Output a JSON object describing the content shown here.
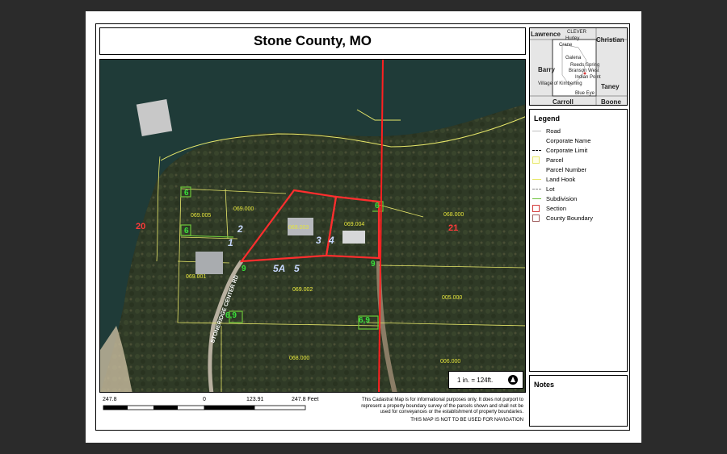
{
  "title": "Stone County, MO",
  "inset_map": {
    "labels": [
      "Lawrence",
      "Christian",
      "Barry",
      "Taney",
      "Carroll",
      "Boone",
      "CLEVER",
      "Hurley",
      "Crane",
      "Galena",
      "Reeds Spring",
      "Branson West",
      "Indian Point",
      "Village of Kimberling",
      "Blue Eye"
    ]
  },
  "map": {
    "parcel_numbers": [
      "069.005",
      "069.000",
      "069.003",
      "069.004",
      "068.000",
      "069.001",
      "069.002",
      "005.000",
      "068.000",
      "006.000"
    ],
    "sections": [
      "20",
      "21"
    ],
    "lots": [
      "1",
      "2",
      "3",
      "4",
      "5A",
      "5"
    ],
    "subdivision_marks": [
      "6",
      "6",
      "6",
      "9",
      "9",
      "6,9",
      "6,9"
    ],
    "road_name": "STONERIDGE CENTER RD"
  },
  "scale_text": "1 in. = 124ft.",
  "north_arrow_icon": "north-arrow-icon",
  "scalebar": {
    "ticks": [
      "247.8",
      "0",
      "123.91",
      "247.8 Feet"
    ]
  },
  "legend": {
    "title": "Legend",
    "items": [
      {
        "label": "Road",
        "symbol": "line",
        "color": "#bfbfbf"
      },
      {
        "label": "Corporate Name",
        "symbol": "blank",
        "color": "#ffffff"
      },
      {
        "label": "Corporate Limit",
        "symbol": "dash",
        "color": "#000000"
      },
      {
        "label": "Parcel",
        "symbol": "box",
        "color": "#e8e86a",
        "fill": "#ffffe6"
      },
      {
        "label": "Parcel Number",
        "symbol": "blank",
        "color": "#ffffff"
      },
      {
        "label": "Land Hook",
        "symbol": "line",
        "color": "#e8e86a"
      },
      {
        "label": "Lot",
        "symbol": "dash",
        "color": "#888888"
      },
      {
        "label": "Subdivision",
        "symbol": "line",
        "color": "#6cc23a"
      },
      {
        "label": "Section",
        "symbol": "box",
        "color": "#d43a3a"
      },
      {
        "label": "County Boundary",
        "symbol": "box",
        "color": "#a06060"
      }
    ]
  },
  "notes": {
    "title": "Notes"
  },
  "disclaimer": {
    "text": "This Cadastral Map is for informational purposes only.  It does not purport to represent a property boundary survey of the parcels shown and shall not be used for conveyances or the establishment of property boundaries.",
    "nav": "THIS MAP IS NOT TO BE USED FOR NAVIGATION"
  }
}
